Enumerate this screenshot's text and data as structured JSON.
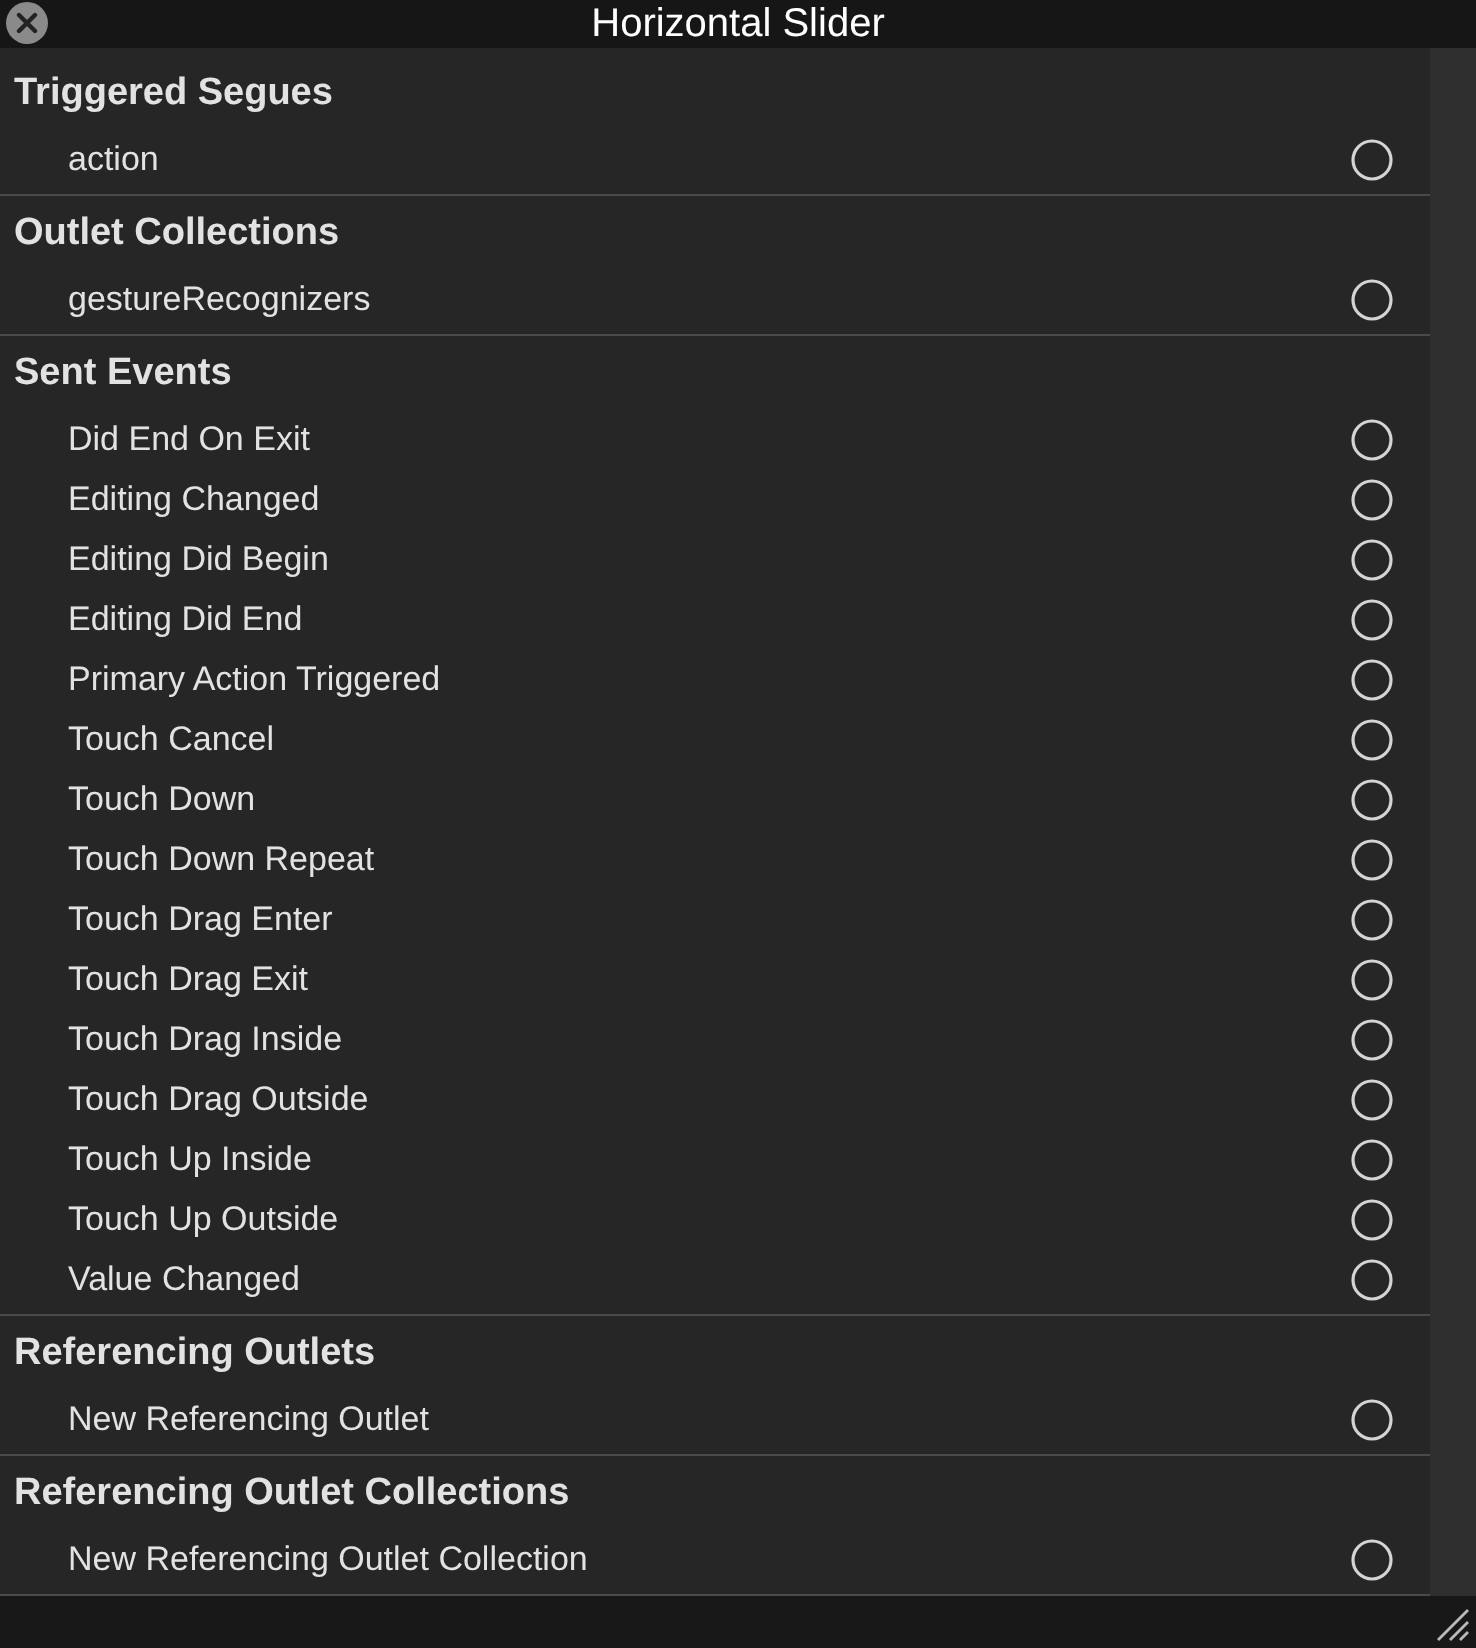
{
  "window": {
    "title": "Horizontal Slider"
  },
  "sections": [
    {
      "title": "Triggered Segues",
      "items": [
        {
          "label": "action",
          "connected": false
        }
      ]
    },
    {
      "title": "Outlet Collections",
      "items": [
        {
          "label": "gestureRecognizers",
          "connected": false
        }
      ]
    },
    {
      "title": "Sent Events",
      "items": [
        {
          "label": "Did End On Exit",
          "connected": false
        },
        {
          "label": "Editing Changed",
          "connected": false
        },
        {
          "label": "Editing Did Begin",
          "connected": false
        },
        {
          "label": "Editing Did End",
          "connected": false
        },
        {
          "label": "Primary Action Triggered",
          "connected": false
        },
        {
          "label": "Touch Cancel",
          "connected": false
        },
        {
          "label": "Touch Down",
          "connected": false
        },
        {
          "label": "Touch Down Repeat",
          "connected": false
        },
        {
          "label": "Touch Drag Enter",
          "connected": false
        },
        {
          "label": "Touch Drag Exit",
          "connected": false
        },
        {
          "label": "Touch Drag Inside",
          "connected": false
        },
        {
          "label": "Touch Drag Outside",
          "connected": false
        },
        {
          "label": "Touch Up Inside",
          "connected": false
        },
        {
          "label": "Touch Up Outside",
          "connected": false
        },
        {
          "label": "Value Changed",
          "connected": false
        }
      ]
    },
    {
      "title": "Referencing Outlets",
      "items": [
        {
          "label": "New Referencing Outlet",
          "connected": false
        }
      ]
    },
    {
      "title": "Referencing Outlet Collections",
      "items": [
        {
          "label": "New Referencing Outlet Collection",
          "connected": false
        }
      ]
    }
  ]
}
